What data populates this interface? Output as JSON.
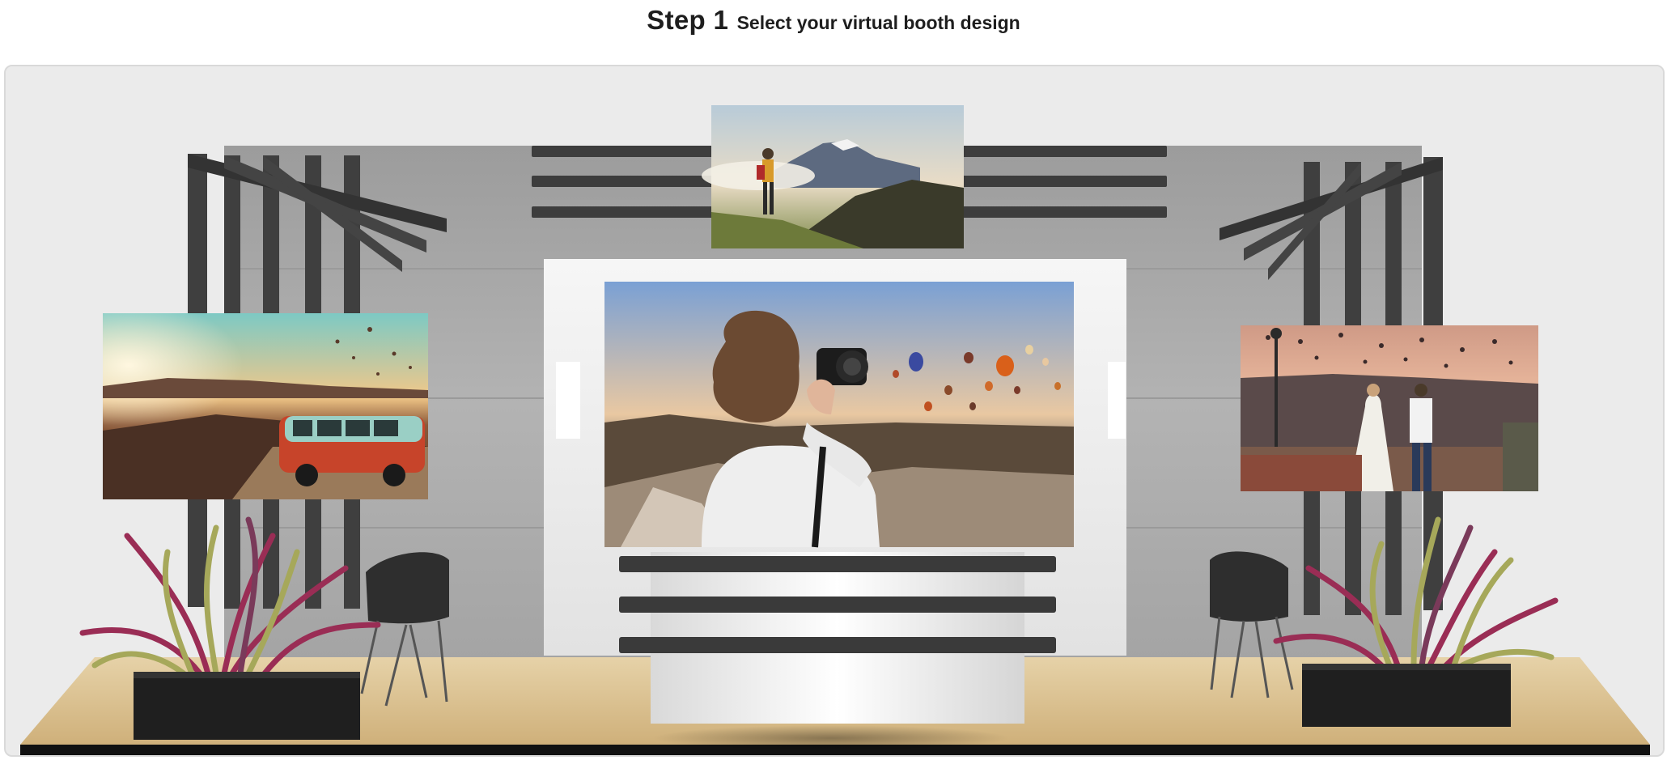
{
  "header": {
    "step_label": "Step 1",
    "instruction": "Select your virtual booth design"
  },
  "booth": {
    "screens": [
      {
        "id": "screen-top",
        "scene": "hiker-mountain-sunrise"
      },
      {
        "id": "screen-left",
        "scene": "van-cliff-balloons"
      },
      {
        "id": "screen-center",
        "scene": "photographer-balloons"
      },
      {
        "id": "screen-right",
        "scene": "couple-rooftop-balloons"
      }
    ],
    "colors": {
      "concrete": "#a9a9a9",
      "frame": "#3f3f3f",
      "floor": "#d8bf93",
      "leaf_red": "#9a2d55",
      "leaf_green": "#a6a85a"
    }
  }
}
